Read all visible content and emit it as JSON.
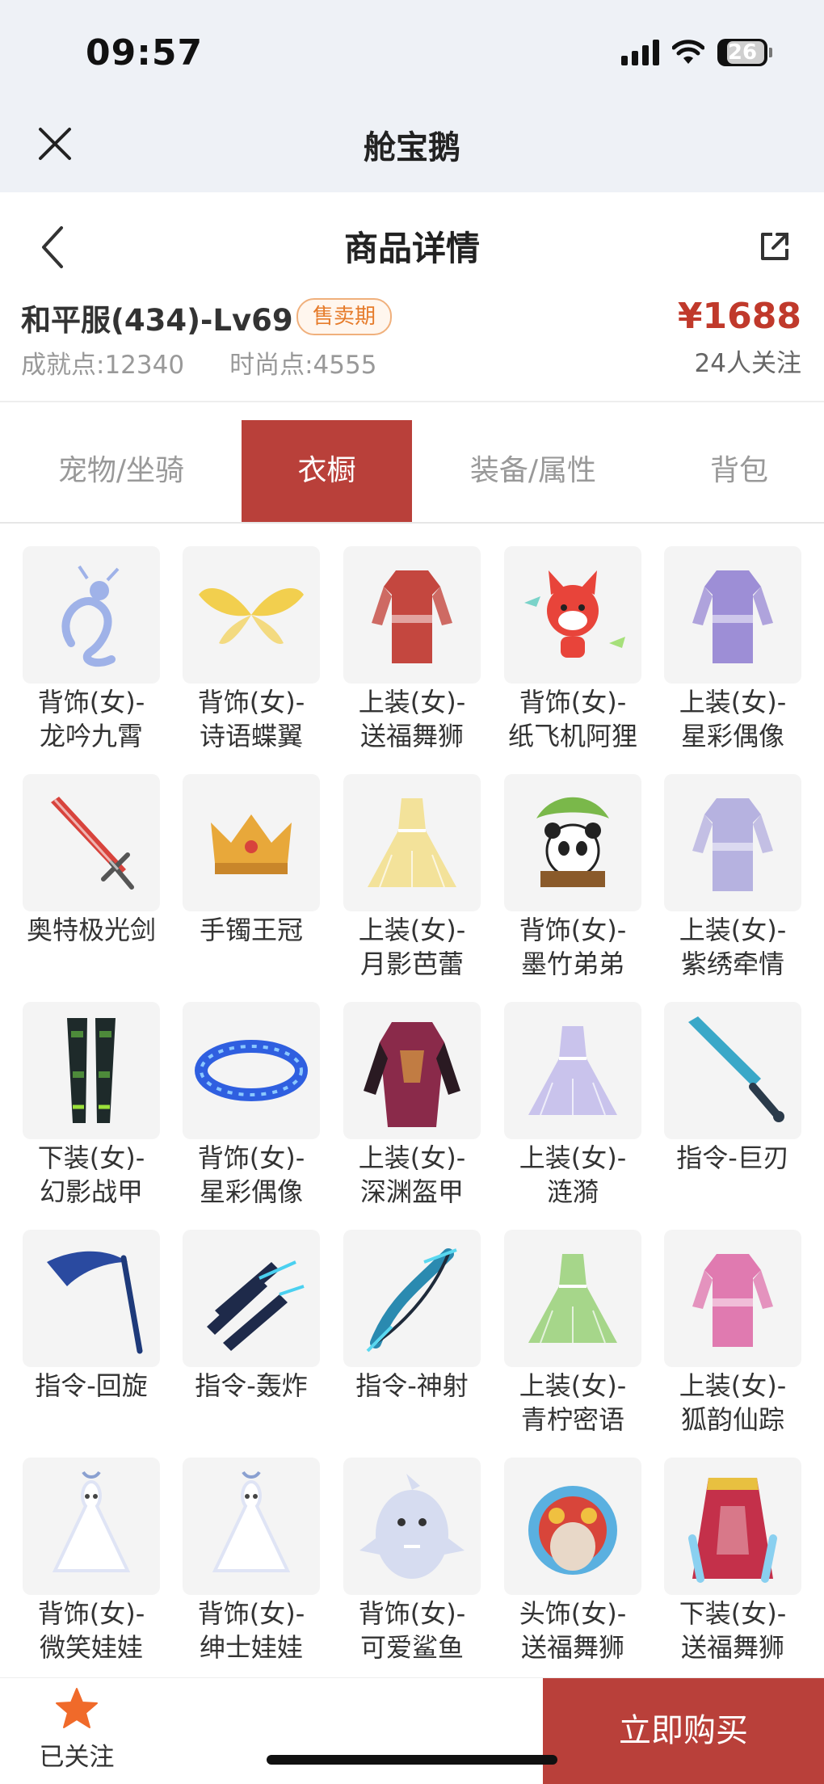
{
  "status": {
    "time": "09:57",
    "battery": "26"
  },
  "app": {
    "title": "舱宝鹅"
  },
  "nav": {
    "title": "商品详情"
  },
  "product": {
    "name": "和平服(434)-Lv69",
    "badge": "售卖期",
    "achievement_label": "成就点:",
    "achievement_value": "12340",
    "fashion_label": "时尚点:",
    "fashion_value": "4555",
    "price": "¥1688",
    "followers": "24人关注"
  },
  "tabs": [
    {
      "label": "宠物/坐骑",
      "active": false
    },
    {
      "label": "衣橱",
      "active": true
    },
    {
      "label": "装备/属性",
      "active": false
    },
    {
      "label": "背包",
      "active": false
    }
  ],
  "items": [
    {
      "label": "背饰(女)-\n龙吟九霄",
      "icon": "dragon-icon",
      "color": "#9fb2e8"
    },
    {
      "label": "背饰(女)-\n诗语蝶翼",
      "icon": "wings-icon",
      "color": "#f2cf4e"
    },
    {
      "label": "上装(女)-\n送福舞狮",
      "icon": "outfit-icon",
      "color": "#c4473f"
    },
    {
      "label": "背饰(女)-\n纸飞机阿狸",
      "icon": "fox-icon",
      "color": "#e8443a"
    },
    {
      "label": "上装(女)-\n星彩偶像",
      "icon": "outfit-icon",
      "color": "#9d8ed6"
    },
    {
      "label": "奥特极光剑",
      "icon": "sword-icon",
      "color": "#d8433c"
    },
    {
      "label": "手镯王冠",
      "icon": "crown-icon",
      "color": "#e8a83a"
    },
    {
      "label": "上装(女)-\n月影芭蕾",
      "icon": "dress-icon",
      "color": "#f3e29a"
    },
    {
      "label": "背饰(女)-\n墨竹弟弟",
      "icon": "panda-icon",
      "color": "#7ab84a"
    },
    {
      "label": "上装(女)-\n紫绣牵情",
      "icon": "outfit-icon",
      "color": "#b6b2e0"
    },
    {
      "label": "下装(女)-\n幻影战甲",
      "icon": "legs-icon",
      "color": "#4d8a3a"
    },
    {
      "label": "背饰(女)-\n星彩偶像",
      "icon": "ring-icon",
      "color": "#2f5fe0"
    },
    {
      "label": "上装(女)-\n深渊盔甲",
      "icon": "armor-icon",
      "color": "#8a2a4a"
    },
    {
      "label": "上装(女)-\n涟漪",
      "icon": "dress-icon",
      "color": "#c9c3ec"
    },
    {
      "label": "指令-巨刃",
      "icon": "blade-icon",
      "color": "#3aa8c8"
    },
    {
      "label": "指令-回旋",
      "icon": "scythe-icon",
      "color": "#2a4aa0"
    },
    {
      "label": "指令-轰炸",
      "icon": "claw-icon",
      "color": "#1e2a4a"
    },
    {
      "label": "指令-神射",
      "icon": "bow-icon",
      "color": "#2a8ab0"
    },
    {
      "label": "上装(女)-\n青柠密语",
      "icon": "dress-icon",
      "color": "#a6d68a"
    },
    {
      "label": "上装(女)-\n狐韵仙踪",
      "icon": "outfit-icon",
      "color": "#e07ab0"
    },
    {
      "label": "背饰(女)-\n微笑娃娃",
      "icon": "doll-icon",
      "color": "#dfe4f5"
    },
    {
      "label": "背饰(女)-\n绅士娃娃",
      "icon": "doll-icon",
      "color": "#dfe4f5"
    },
    {
      "label": "背饰(女)-\n可爱鲨鱼",
      "icon": "shark-icon",
      "color": "#d6dcf0"
    },
    {
      "label": "头饰(女)-\n送福舞狮",
      "icon": "lionhead-icon",
      "color": "#d8453a"
    },
    {
      "label": "下装(女)-\n送福舞狮",
      "icon": "skirt-icon",
      "color": "#c4304a"
    }
  ],
  "bottom": {
    "follow_label": "已关注",
    "buy_label": "立即购买"
  },
  "colors": {
    "accent": "#b9403a",
    "price": "#c0392b",
    "star": "#f06a2a",
    "badge": "#e67c2c"
  }
}
